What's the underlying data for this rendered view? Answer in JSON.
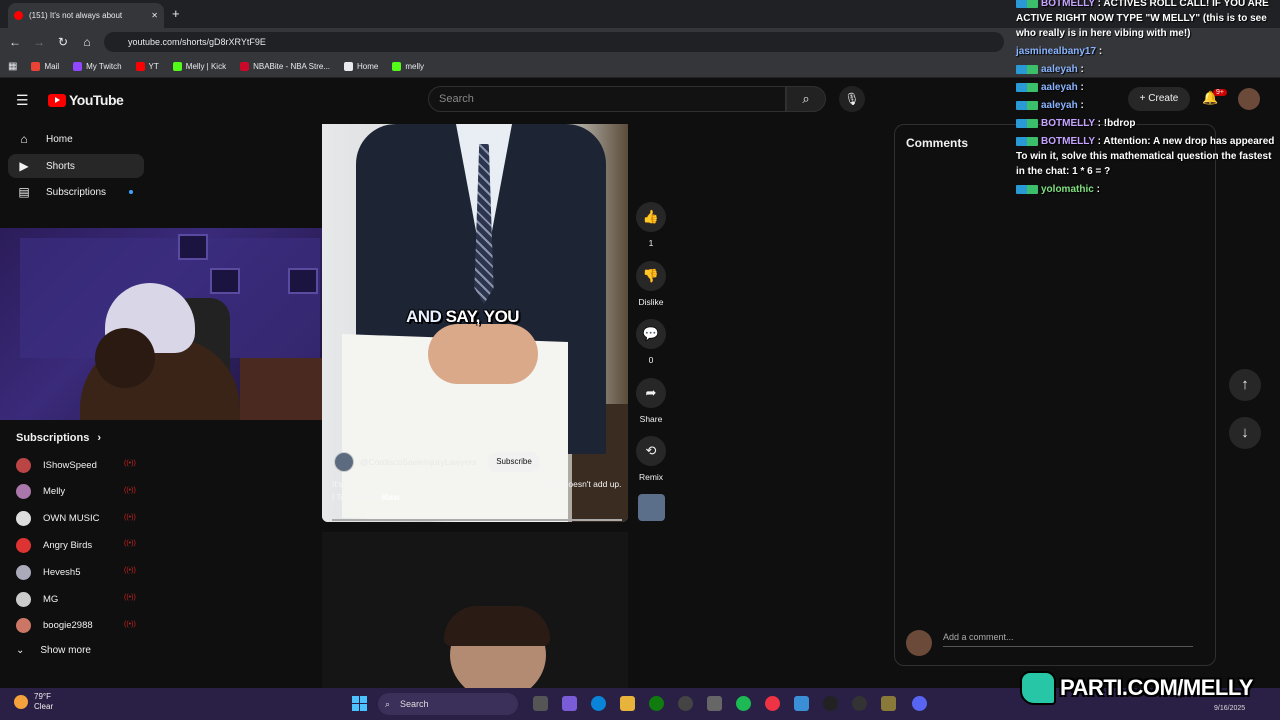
{
  "browser": {
    "tab_title": "(151) It's not always about",
    "url": "youtube.com/shorts/gD8rXRYtF9E",
    "bookmarks": [
      {
        "label": "Mail",
        "color": "#ea4335"
      },
      {
        "label": "My Twitch",
        "color": "#9146ff"
      },
      {
        "label": "YT",
        "color": "#ff0000"
      },
      {
        "label": "Melly | Kick",
        "color": "#53fc18"
      },
      {
        "label": "NBABite - NBA Stre...",
        "color": "#c9082a"
      },
      {
        "label": "Home",
        "color": "#e8eaed"
      },
      {
        "label": "melly",
        "color": "#53fc18"
      }
    ]
  },
  "youtube": {
    "logo_text": "YouTube",
    "search_placeholder": "Search",
    "create_label": "Create",
    "notif_badge": "9+",
    "nav": [
      {
        "label": "Home",
        "icon": "home-icon"
      },
      {
        "label": "Shorts",
        "icon": "shorts-icon"
      },
      {
        "label": "Subscriptions",
        "icon": "subscriptions-icon"
      }
    ],
    "subscriptions_title": "Subscriptions",
    "subscriptions": [
      {
        "name": "IShowSpeed",
        "color": "#b44"
      },
      {
        "name": "Melly",
        "color": "#a7a"
      },
      {
        "name": "OWN MUSIC",
        "color": "#ddd"
      },
      {
        "name": "Angry Birds",
        "color": "#d33"
      },
      {
        "name": "Hevesh5",
        "color": "#aab"
      },
      {
        "name": "MG",
        "color": "#ccc"
      },
      {
        "name": "boogie2988",
        "color": "#c76"
      }
    ],
    "show_more": "Show more"
  },
  "short": {
    "caption_word1": "AND",
    "caption_rest": "SAY, YOU",
    "channel": "@CordiscoSaeleInjuryLawyers",
    "subscribe_label": "Subscribe",
    "description": "It's not always about what's said… sometimes it's about what doesn't add up. | Todd Sailer",
    "hashtag": "#law",
    "actions": [
      {
        "icon": "thumbs-up-icon",
        "glyph": "👍",
        "label": "1"
      },
      {
        "icon": "thumbs-down-icon",
        "glyph": "👎",
        "label": "Dislike"
      },
      {
        "icon": "comment-icon",
        "glyph": "💬",
        "label": "0"
      },
      {
        "icon": "share-icon",
        "glyph": "➦",
        "label": "Share"
      },
      {
        "icon": "remix-icon",
        "glyph": "⟲",
        "label": "Remix"
      }
    ]
  },
  "comments_panel": {
    "title": "Comments",
    "add_placeholder": "Add a comment..."
  },
  "chat": [
    {
      "user": "BOTMELLY",
      "kind": "bot",
      "text": "ACTIVES ROLL CALL! IF YOU ARE ACTIVE RIGHT NOW TYPE \"W MELLY\" (this is to see who really is in here vibing with me!)"
    },
    {
      "user": "jasminealbany17",
      "kind": "plain",
      "text": ""
    },
    {
      "user": "aaleyah",
      "kind": "sub",
      "text": ""
    },
    {
      "user": "aaleyah",
      "kind": "sub",
      "text": ""
    },
    {
      "user": "aaleyah",
      "kind": "sub",
      "text": ""
    },
    {
      "user": "BOTMELLY",
      "kind": "bot",
      "text": "!bdrop"
    },
    {
      "user": "BOTMELLY",
      "kind": "bot",
      "text": "Attention: A new drop has appeared To win it, solve this mathematical question the fastest in the chat: 1 * 6 = ?"
    },
    {
      "user": "yolomathic",
      "kind": "green",
      "text": ""
    }
  ],
  "overlay": {
    "brand": "PARTI.COM/MELLY"
  },
  "taskbar": {
    "temp": "79°F",
    "condition": "Clear",
    "search_label": "Search",
    "date": "9/16/2025"
  }
}
